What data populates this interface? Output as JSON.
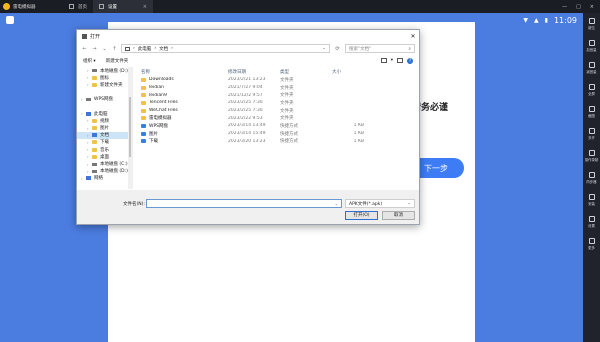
{
  "emulator": {
    "app_name": "雷电模拟器",
    "tabs": [
      {
        "label": "首页",
        "icon": "home-icon"
      },
      {
        "label": "设置",
        "icon": "gear-icon"
      }
    ],
    "window_controls": [
      "—",
      "□",
      "×"
    ]
  },
  "android": {
    "time": "11:09",
    "card_text": "请务必谨",
    "card_button": "下一步"
  },
  "right_sidebar": [
    {
      "label": "键位",
      "icon": "keyboard-icon"
    },
    {
      "label": "加音量",
      "icon": "volume-up-icon"
    },
    {
      "label": "减音量",
      "icon": "volume-down-icon"
    },
    {
      "label": "全屏",
      "icon": "fullscreen-icon"
    },
    {
      "label": "截图",
      "icon": "screenshot-icon"
    },
    {
      "label": "多开",
      "icon": "multi-instance-icon"
    },
    {
      "label": "操作录制",
      "icon": "record-icon"
    },
    {
      "label": "同步器",
      "icon": "sync-icon"
    },
    {
      "label": "安装",
      "icon": "install-icon"
    },
    {
      "label": "设置",
      "icon": "gear-icon"
    },
    {
      "label": "更多",
      "icon": "more-icon"
    }
  ],
  "dialog": {
    "title": "打开",
    "close": "✕",
    "breadcrumb": [
      "此电脑",
      "文档"
    ],
    "search_placeholder": "搜索\"文档\"",
    "organize": "组织 ▾",
    "new_folder": "新建文件夹",
    "nav_items": [
      {
        "label": "本地磁盘 (D:)",
        "icon": "drive-icon",
        "indent": 1
      },
      {
        "label": "图标",
        "icon": "folder-icon",
        "indent": 1
      },
      {
        "label": "新建文件夹",
        "icon": "folder-icon",
        "indent": 1
      },
      {
        "label": "",
        "icon": "",
        "indent": 0
      },
      {
        "label": "WPS网盘",
        "icon": "cloud-drive-icon",
        "indent": 0
      },
      {
        "label": "",
        "icon": "",
        "indent": 0
      },
      {
        "label": "此电脑",
        "icon": "computer-icon",
        "indent": 0
      },
      {
        "label": "视频",
        "icon": "video-folder-icon",
        "indent": 1
      },
      {
        "label": "图片",
        "icon": "picture-folder-icon",
        "indent": 1
      },
      {
        "label": "文档",
        "icon": "document-folder-icon",
        "indent": 1,
        "selected": true
      },
      {
        "label": "下载",
        "icon": "download-folder-icon",
        "indent": 1
      },
      {
        "label": "音乐",
        "icon": "music-folder-icon",
        "indent": 1
      },
      {
        "label": "桌面",
        "icon": "desktop-folder-icon",
        "indent": 1
      },
      {
        "label": "本地磁盘 (C:)",
        "icon": "drive-icon",
        "indent": 1
      },
      {
        "label": "本地磁盘 (D:)",
        "icon": "drive-icon",
        "indent": 1
      },
      {
        "label": "网络",
        "icon": "network-icon",
        "indent": 0
      }
    ],
    "columns": [
      "名称",
      "修改日期",
      "类型",
      "大小"
    ],
    "files": [
      {
        "name": "Downloads",
        "date": "2023/2/21 13:23",
        "type": "文件夹",
        "size": "",
        "kind": "folder"
      },
      {
        "name": "leidian",
        "date": "2021/7/27 9:04",
        "type": "文件夹",
        "size": "",
        "kind": "folder"
      },
      {
        "name": "leidian9",
        "date": "2021/12/2 9:57",
        "type": "文件夹",
        "size": "",
        "kind": "folder"
      },
      {
        "name": "Tencent Files",
        "date": "2023/2/25 7:30",
        "type": "文件夹",
        "size": "",
        "kind": "folder"
      },
      {
        "name": "WeChat Files",
        "date": "2023/2/25 7:30",
        "type": "文件夹",
        "size": "",
        "kind": "folder"
      },
      {
        "name": "雷电模拟器",
        "date": "2023/2/22 9:53",
        "type": "文件夹",
        "size": "",
        "kind": "folder"
      },
      {
        "name": "WPS网盘",
        "date": "2023/3/14 13:49",
        "type": "快捷方式",
        "size": "1 KB",
        "kind": "shortcut"
      },
      {
        "name": "图片",
        "date": "2023/3/14 15:49",
        "type": "快捷方式",
        "size": "1 KB",
        "kind": "shortcut"
      },
      {
        "name": "下载",
        "date": "2023/3/20 13:23",
        "type": "快捷方式",
        "size": "1 KB",
        "kind": "shortcut"
      }
    ],
    "filename_label": "文件名(N):",
    "filename_value": "",
    "filetype": "APK文件(*.apk)",
    "open_button": "打开(O)",
    "cancel_button": "取消"
  }
}
